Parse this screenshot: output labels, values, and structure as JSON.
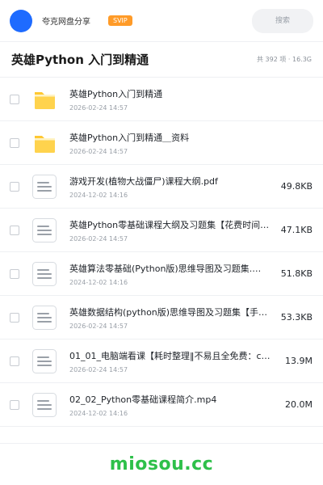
{
  "header": {
    "owner_name": "夸克网盘分享",
    "badge": "SVIP",
    "search_placeholder": "搜索"
  },
  "title_bar": {
    "title": "英雄Python 入门到精通",
    "stats": "共 392 项 · 16.3G"
  },
  "files": [
    {
      "type": "folder",
      "name": "英雄Python入门到精通",
      "date": "2026-02-24 14:57",
      "size": ""
    },
    {
      "type": "folder",
      "name": "英雄Python入门到精通＿资料",
      "date": "2026-02-24 14:57",
      "size": ""
    },
    {
      "type": "doc",
      "name": "游戏开发(植物大战僵尸)课程大纲.pdf",
      "date": "2024-12-02 14:16",
      "size": "49.8KB"
    },
    {
      "type": "doc",
      "name": "英雄Python零基础课程大纲及习题集【花费时间‖…",
      "date": "2026-02-24 14:57",
      "size": "47.1KB"
    },
    {
      "type": "doc",
      "name": "英雄算法零基础(Python版)思维导图及习题集.…",
      "date": "2024-12-02 14:16",
      "size": "51.8KB"
    },
    {
      "type": "doc",
      "name": "英雄数据结构(python版)思维导图及习题集【手…",
      "date": "2026-02-24 14:57",
      "size": "53.3KB"
    },
    {
      "type": "doc",
      "name": "01_01_电脑端看课【耗时整理‖不易且全免费：c…",
      "date": "2026-02-24 14:57",
      "size": "13.9M"
    },
    {
      "type": "doc",
      "name": "02_02_Python零基础课程简介.mp4",
      "date": "2024-12-02 14:16",
      "size": "20.0M"
    }
  ],
  "footer": {
    "brand": "miosou.cc"
  },
  "colors": {
    "accent_blue": "#1e6bff",
    "svip_orange": "#ff9b28",
    "folder_yellow": "#ffc832",
    "brand_green": "#2ec04a"
  }
}
